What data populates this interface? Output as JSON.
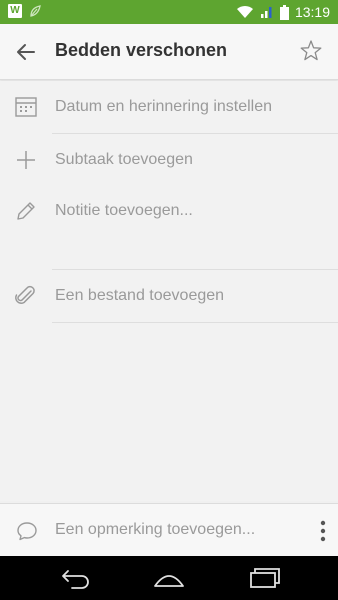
{
  "status_bar": {
    "time": "13:19",
    "app_icon_letter": "W"
  },
  "header": {
    "title": "Bedden verschonen"
  },
  "rows": {
    "date": "Datum en herinnering instellen",
    "subtask": "Subtaak toevoegen",
    "note": "Notitie toevoegen...",
    "file": "Een bestand toevoegen"
  },
  "footer": {
    "comment_placeholder": "Een opmerking toevoegen..."
  },
  "colors": {
    "status_bar": "#5ea530",
    "icon": "#9a9a9a",
    "title": "#333333"
  },
  "icons": [
    "back-arrow-icon",
    "star-icon",
    "calendar-icon",
    "plus-icon",
    "pencil-icon",
    "paperclip-icon",
    "comment-icon",
    "more-vert-icon"
  ]
}
